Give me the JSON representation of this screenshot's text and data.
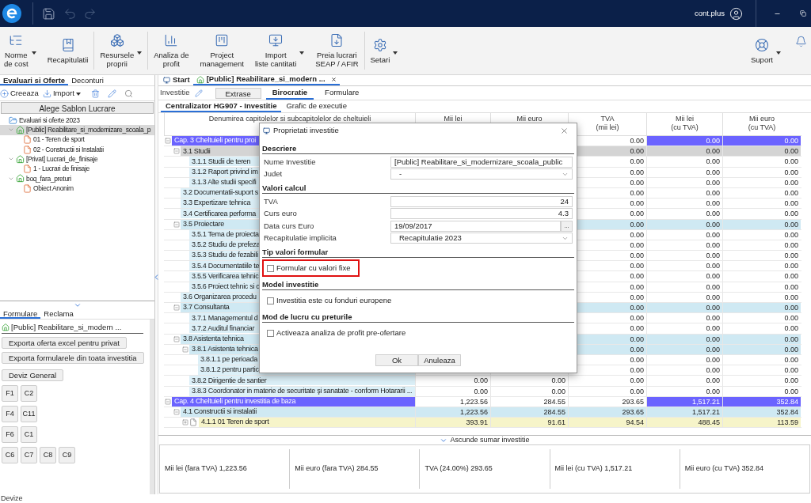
{
  "app_bar": {
    "account": "cont.plus"
  },
  "ribbon": [
    {
      "lines": [
        "Norme",
        "de cost"
      ],
      "dropdown": true
    },
    {
      "lines": [
        "Recapitulatii"
      ],
      "dropdown": false
    },
    {
      "lines": [
        "Resursele",
        "proprii"
      ],
      "dropdown": true
    },
    {
      "lines": [
        "Analiza de",
        "profit"
      ],
      "dropdown": false
    },
    {
      "lines": [
        "Project",
        "management"
      ],
      "dropdown": false
    },
    {
      "lines": [
        "Import",
        "liste cantitati"
      ],
      "dropdown": true
    },
    {
      "lines": [
        "Preia lucrari",
        "SEAP / AFIR"
      ],
      "dropdown": false
    },
    {
      "lines": [
        "Setari"
      ],
      "dropdown": true
    }
  ],
  "ribbon_right": [
    {
      "lines": [
        "Suport"
      ],
      "dropdown": true
    }
  ],
  "left_tabs": [
    {
      "label": "Evaluari si Oferte",
      "selected": true
    },
    {
      "label": "Deconturi",
      "selected": false
    }
  ],
  "left_toolbar": [
    {
      "label": "Creeaza",
      "dropdown": false
    },
    {
      "label": "Import",
      "dropdown": true
    }
  ],
  "template_button": "Alege Sablon Lucrare",
  "tree": [
    {
      "label": "Evaluari si oferte 2023",
      "kind": "folder",
      "selected": false,
      "children": [
        {
          "label": "[Public] Reabilitare_si_modernizare_scoala_p",
          "kind": "investment",
          "selected": true,
          "expanded": true,
          "children": [
            {
              "label": "01 - Teren de sport",
              "kind": "object",
              "selected": false
            },
            {
              "label": "02 - Constructii si Instalatii",
              "kind": "object",
              "selected": false
            }
          ]
        },
        {
          "label": "[Privat] Lucrari_de_finisaje",
          "kind": "investment",
          "selected": false,
          "expanded": true,
          "children": [
            {
              "label": "1 - Lucrari de finisaje",
              "kind": "object",
              "selected": false
            }
          ]
        },
        {
          "label": "boq_fara_preturi",
          "kind": "investment",
          "selected": false,
          "expanded": true,
          "children": [
            {
              "label": "Obiect Anonim",
              "kind": "object",
              "selected": false
            }
          ]
        }
      ]
    }
  ],
  "form_tabs": [
    {
      "label": "Formulare",
      "selected": true
    },
    {
      "label": "Reclama",
      "selected": false
    }
  ],
  "form_investment": "[Public] Reabilitare_si_modern ...",
  "export_buttons": [
    "Exporta oferta excel pentru privat",
    "Exporta formularele din toata investitia"
  ],
  "general_button": "Deviz General",
  "form_button_rows": [
    [
      "F1",
      "C2"
    ],
    [
      "F4",
      "C11"
    ],
    [
      "F6",
      "C1"
    ],
    [
      "C6",
      "C7",
      "C8",
      "C9"
    ]
  ],
  "status_bar": "Devize",
  "doc_tabs": [
    {
      "label": "Start",
      "kind": "start",
      "selected": false
    },
    {
      "label": "[Public] Reabilitare_si_modern ...",
      "kind": "investment",
      "selected": true
    }
  ],
  "investment_label": "Investitie",
  "extract_button": "Extrase",
  "section_tabs": [
    {
      "label": "Birocratie",
      "selected": true
    },
    {
      "label": "Formulare",
      "selected": false
    }
  ],
  "sheet_tabs": [
    {
      "label": "Centralizator HG907 - Investitie",
      "selected": true
    },
    {
      "label": "Grafic de executie",
      "selected": false
    }
  ],
  "table": {
    "columns": [
      [
        "Denumirea capitolelor si subcapitolelor de cheltuieli"
      ],
      [
        "Mii lei"
      ],
      [
        "Mii euro"
      ],
      [
        "TVA",
        "(mii lei)"
      ],
      [
        "Mii lei",
        "(cu TVA)"
      ],
      [
        "Mii euro",
        "(cu TVA)"
      ]
    ],
    "rows": [
      {
        "name": "Cap. 3 Cheltuieli pentru proi",
        "kind": "chapter",
        "selected": false,
        "expanded": true,
        "values": {
          "tva": "0.00",
          "mii_lei_cu_tva": "0.00",
          "mii_euro_cu_tva": "0.00"
        },
        "children": [
          {
            "name": "3.1 Studii",
            "kind": "section",
            "selected": true,
            "expanded": true,
            "values": {
              "tva": "0.00",
              "mii_lei_cu_tva": "0.00",
              "mii_euro_cu_tva": "0.00"
            },
            "children": [
              {
                "name": "3.1.1 Studii de teren",
                "kind": "line",
                "selected": false,
                "values": {
                  "tva": "0.00",
                  "mii_lei_cu_tva": "0.00",
                  "mii_euro_cu_tva": "0.00"
                }
              },
              {
                "name": "3.1.2 Raport privind im",
                "kind": "line",
                "selected": false,
                "values": {
                  "tva": "0.00",
                  "mii_lei_cu_tva": "0.00",
                  "mii_euro_cu_tva": "0.00"
                }
              },
              {
                "name": "3.1.3 Alte studii specifi",
                "kind": "line",
                "selected": false,
                "values": {
                  "tva": "0.00",
                  "mii_lei_cu_tva": "0.00",
                  "mii_euro_cu_tva": "0.00"
                }
              }
            ]
          },
          {
            "name": "3.2 Documentatii-suport s",
            "kind": "line",
            "selected": false,
            "values": {
              "tva": "0.00",
              "mii_lei_cu_tva": "0.00",
              "mii_euro_cu_tva": "0.00"
            }
          },
          {
            "name": "3.3 Expertizare tehnica",
            "kind": "line",
            "selected": false,
            "values": {
              "tva": "0.00",
              "mii_lei_cu_tva": "0.00",
              "mii_euro_cu_tva": "0.00"
            }
          },
          {
            "name": "3.4 Certificarea performa",
            "kind": "line",
            "selected": false,
            "values": {
              "tva": "0.00",
              "mii_lei_cu_tva": "0.00",
              "mii_euro_cu_tva": "0.00"
            }
          },
          {
            "name": "3.5 Proiectare",
            "kind": "section",
            "selected": false,
            "expanded": true,
            "values": {
              "tva": "0.00",
              "mii_lei_cu_tva": "0.00",
              "mii_euro_cu_tva": "0.00"
            },
            "children": [
              {
                "name": "3.5.1 Tema de proiecta",
                "kind": "line",
                "selected": false,
                "values": {
                  "tva": "0.00",
                  "mii_lei_cu_tva": "0.00",
                  "mii_euro_cu_tva": "0.00"
                }
              },
              {
                "name": "3.5.2 Studiu de prefeza",
                "kind": "line",
                "selected": false,
                "values": {
                  "tva": "0.00",
                  "mii_lei_cu_tva": "0.00",
                  "mii_euro_cu_tva": "0.00"
                }
              },
              {
                "name": "3.5.3 Studiu de fezabili",
                "kind": "line",
                "selected": false,
                "values": {
                  "tva": "0.00",
                  "mii_lei_cu_tva": "0.00",
                  "mii_euro_cu_tva": "0.00"
                }
              },
              {
                "name": "3.5.4 Documentatiile te",
                "kind": "line",
                "selected": false,
                "values": {
                  "tva": "0.00",
                  "mii_lei_cu_tva": "0.00",
                  "mii_euro_cu_tva": "0.00"
                }
              },
              {
                "name": "3.5.5 Verificarea tehnic",
                "kind": "line",
                "selected": false,
                "values": {
                  "tva": "0.00",
                  "mii_lei_cu_tva": "0.00",
                  "mii_euro_cu_tva": "0.00"
                }
              },
              {
                "name": "3.5.6 Proiect tehnic si c",
                "kind": "line",
                "selected": false,
                "values": {
                  "tva": "0.00",
                  "mii_lei_cu_tva": "0.00",
                  "mii_euro_cu_tva": "0.00"
                }
              }
            ]
          },
          {
            "name": "3.6 Organizarea procedu",
            "kind": "line",
            "selected": false,
            "values": {
              "tva": "0.00",
              "mii_lei_cu_tva": "0.00",
              "mii_euro_cu_tva": "0.00"
            }
          },
          {
            "name": "3.7 Consultanta",
            "kind": "section",
            "selected": false,
            "expanded": true,
            "values": {
              "tva": "0.00",
              "mii_lei_cu_tva": "0.00",
              "mii_euro_cu_tva": "0.00"
            },
            "children": [
              {
                "name": "3.7.1 Managementul d",
                "kind": "line",
                "selected": false,
                "values": {
                  "tva": "0.00",
                  "mii_lei_cu_tva": "0.00",
                  "mii_euro_cu_tva": "0.00"
                }
              },
              {
                "name": "3.7.2 Auditul financiar",
                "kind": "line",
                "selected": false,
                "values": {
                  "tva": "0.00",
                  "mii_lei_cu_tva": "0.00",
                  "mii_euro_cu_tva": "0.00"
                }
              }
            ]
          },
          {
            "name": "3.8 Asistenta tehnica",
            "kind": "section",
            "selected": false,
            "expanded": true,
            "values": {
              "tva": "0.00",
              "mii_lei_cu_tva": "0.00",
              "mii_euro_cu_tva": "0.00"
            },
            "children": [
              {
                "name": "3.8.1 Asistenta tehnica",
                "kind": "section",
                "selected": false,
                "expanded": true,
                "values": {
                  "tva": "0.00",
                  "mii_lei_cu_tva": "0.00",
                  "mii_euro_cu_tva": "0.00"
                },
                "children": [
                  {
                    "name": "3.8.1.1 pe perioada",
                    "kind": "line",
                    "selected": false,
                    "values": {
                      "tva": "0.00",
                      "mii_lei_cu_tva": "0.00",
                      "mii_euro_cu_tva": "0.00"
                    }
                  },
                  {
                    "name": "3.8.1.2 pentru partic",
                    "kind": "line",
                    "selected": false,
                    "values": {
                      "tva": "0.00",
                      "mii_lei_cu_tva": "0.00",
                      "mii_euro_cu_tva": "0.00"
                    }
                  }
                ]
              },
              {
                "name": "3.8.2 Dirigentie de santier",
                "kind": "line",
                "selected": false,
                "values": {
                  "mii_lei": "0.00",
                  "mii_euro": "0.00",
                  "tva": "0.00",
                  "mii_lei_cu_tva": "0.00",
                  "mii_euro_cu_tva": "0.00"
                }
              },
              {
                "name": "3.8.3 Coordonator in materie de securitate şi sanatate - conform Hotararii ...",
                "kind": "line",
                "selected": false,
                "values": {
                  "mii_lei": "0.00",
                  "mii_euro": "0.00",
                  "tva": "0.00",
                  "mii_lei_cu_tva": "0.00",
                  "mii_euro_cu_tva": "0.00"
                }
              }
            ]
          }
        ]
      },
      {
        "name": "Cap. 4 Cheltuieli pentru investitia de baza",
        "kind": "chapter",
        "selected": false,
        "expanded": true,
        "values": {
          "mii_lei": "1,223.56",
          "mii_euro": "284.55",
          "tva": "293.65",
          "mii_lei_cu_tva": "1,517.21",
          "mii_euro_cu_tva": "352.84"
        },
        "children": [
          {
            "name": "4.1 Constructii si instalatii",
            "kind": "section",
            "selected": false,
            "expanded": true,
            "values": {
              "mii_lei": "1,223.56",
              "mii_euro": "284.55",
              "tva": "293.65",
              "mii_lei_cu_tva": "1,517.21",
              "mii_euro_cu_tva": "352.84"
            },
            "children": [
              {
                "name": "4.1.1 01 Teren de sport",
                "kind": "object",
                "selected": false,
                "expanded": false,
                "values": {
                  "mii_lei": "393.91",
                  "mii_euro": "91.61",
                  "tva": "94.54",
                  "mii_lei_cu_tva": "488.45",
                  "mii_euro_cu_tva": "113.59"
                }
              }
            ]
          }
        ]
      }
    ]
  },
  "summary_toggle": "Ascunde sumar investitie",
  "summary": [
    "Mii lei (fara TVA) 1,223.56",
    "Mii euro (fara TVA) 284.55",
    "TVA (24.00%) 293.65",
    "Mii lei (cu TVA) 1,517.21",
    "Mii euro (cu TVA) 352.84"
  ],
  "dialog": {
    "title": "Proprietati investitie",
    "sections": [
      {
        "title": "Descriere",
        "fields": [
          {
            "label": "Nume Investitie",
            "kind": "text",
            "value": "[Public] Reabilitare_si_modernizare_scoala_public"
          },
          {
            "label": "Judet",
            "kind": "select",
            "value": "-"
          }
        ]
      },
      {
        "title": "Valori calcul",
        "fields": [
          {
            "label": "TVA",
            "kind": "number",
            "value": "24"
          },
          {
            "label": "Curs euro",
            "kind": "number",
            "value": "4.3"
          },
          {
            "label": "Data curs Euro",
            "kind": "date",
            "value": "19/09/2017",
            "picker": "..."
          },
          {
            "label": "Recapitulatie implicita",
            "kind": "select",
            "value": "Recapitulatie 2023"
          }
        ]
      },
      {
        "title": "Tip valori formular",
        "checkboxes": [
          {
            "label": "Formular cu valori fixe",
            "checked": false,
            "highlighted": true
          }
        ]
      },
      {
        "title": "Model investitie",
        "checkboxes": [
          {
            "label": "Investitia este cu fonduri europene",
            "checked": false,
            "highlighted": false
          }
        ]
      },
      {
        "title": "Mod de lucru cu preturile",
        "checkboxes": [
          {
            "label": "Activeaza analiza de profit pre-ofertare",
            "checked": false,
            "highlighted": false
          }
        ]
      }
    ],
    "buttons": [
      "Ok",
      "Anuleaza"
    ]
  }
}
